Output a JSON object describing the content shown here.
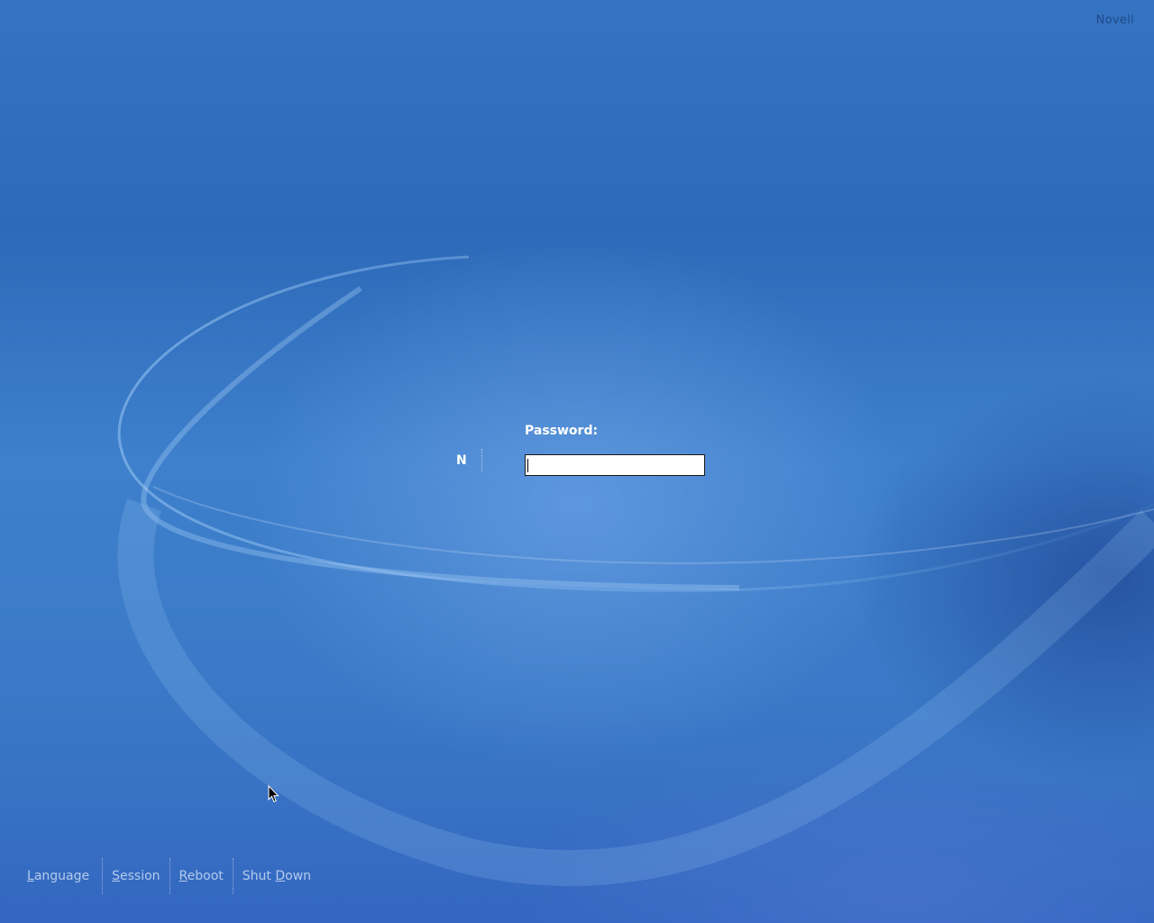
{
  "brand": {
    "text": "Novell"
  },
  "login": {
    "logo_letter": "N",
    "password_label": "Password:",
    "password_value": ""
  },
  "bottom_menu": {
    "items": [
      {
        "label_first": "L",
        "label_rest": "anguage"
      },
      {
        "label_first": "S",
        "label_rest": "ession"
      },
      {
        "label_first": "R",
        "label_rest": "eboot"
      },
      {
        "label_first": "Shut ",
        "label_underlined": "D",
        "label_rest": "own"
      }
    ]
  },
  "colors": {
    "background": "#3573c3",
    "menu_text": "#b3cbec",
    "label_text": "#ffffff",
    "brand_text": "#1f4c86"
  },
  "icons": {
    "pointer": "mouse-pointer-icon",
    "logo": "novell-n-icon"
  }
}
